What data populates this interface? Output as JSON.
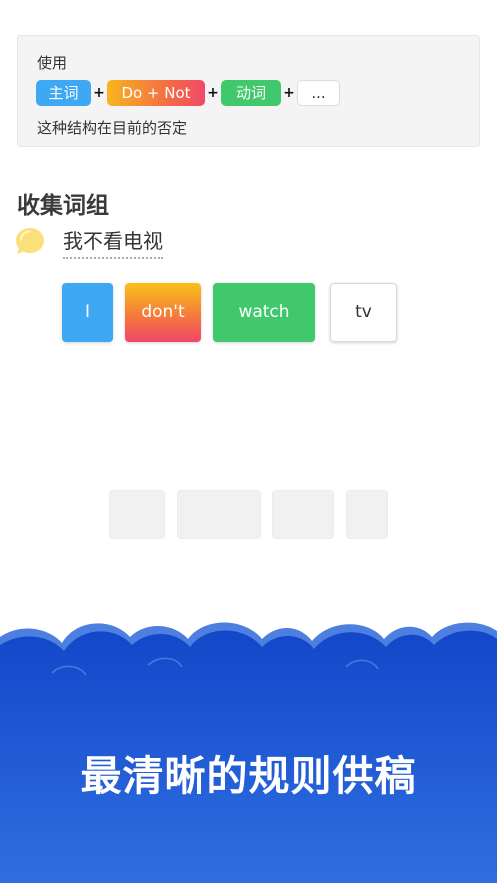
{
  "rule": {
    "intro": "使用",
    "tags": {
      "subject": "主词",
      "do_not": "Do + Not",
      "verb": "动词",
      "more": "..."
    },
    "plus": "+",
    "description": "这种结构在目前的否定"
  },
  "section_title": "收集词组",
  "prompt": {
    "icon": "speech-bubble-icon",
    "text": "我不看电视"
  },
  "word_cards": [
    "I",
    "don't",
    "watch",
    "tv"
  ],
  "answer_slots": 4,
  "banner": {
    "text": "最清晰的规则供稿"
  },
  "colors": {
    "blue": "#3ea8f5",
    "green": "#41c76c",
    "orange": "#f7b51f",
    "pink": "#ef4a68",
    "banner_blue": "#1a56d6",
    "bubble_yellow": "#fbe07a"
  }
}
